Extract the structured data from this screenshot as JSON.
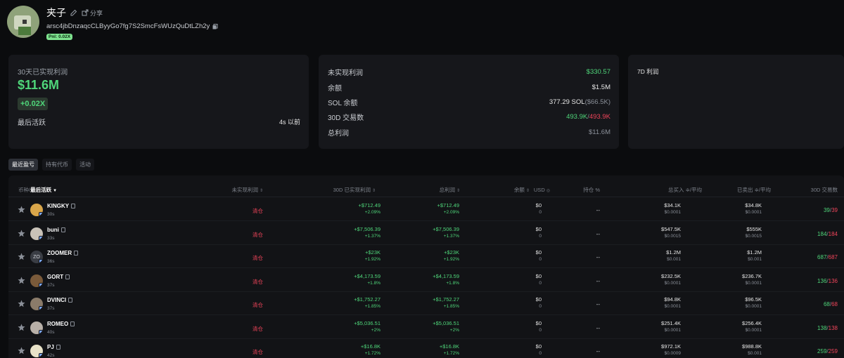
{
  "profile": {
    "name": "夹子",
    "share_label": "分享",
    "address": "arsc4jbDnzaqcCLByyGo7fg7S2SmcFsWUzQuDtLZh2y",
    "pnl_badge": "Pnl: 0.02X"
  },
  "card_realized": {
    "label": "30天已实现利润",
    "value": "$11.6M",
    "multiple": "+0.02X",
    "last_active_label": "最后活跃",
    "last_active_value": "4s 以前"
  },
  "card_stats": {
    "rows": [
      {
        "label": "未实现利润",
        "value": "$330.57"
      },
      {
        "label": "余额",
        "value": "$1.5M"
      },
      {
        "label": "SOL 余额",
        "value": "377.29 SOL",
        "value_paren": "($66.5K)"
      },
      {
        "label": "30D 交易数",
        "buys": "493.9K",
        "sep": "/",
        "sells": "493.9K"
      },
      {
        "label": "总利润",
        "value": "$11.6M"
      }
    ]
  },
  "card_7d": {
    "label": "7D 利润"
  },
  "tabs": [
    {
      "label": "最近盈亏",
      "active": true
    },
    {
      "label": "持有代币",
      "active": false
    },
    {
      "label": "活动",
      "active": false
    }
  ],
  "table": {
    "headers": {
      "token_prefix": "币种/",
      "token_sorted": "最后活跃",
      "unrealized": "未实现利润",
      "realized_30d": "30D 已实现利润",
      "total_profit": "总利润",
      "balance": "余额",
      "usd": "USD",
      "position": "持仓 %",
      "bought": "总买入 ≑/平均",
      "sold": "已卖出 ≑/平均",
      "tx_30d": "30D 交易数"
    },
    "closed_label": "清仓",
    "dash": "--",
    "rows": [
      {
        "name": "KINGKY",
        "age": "30s",
        "realized": "+$712.49",
        "realized_pct": "+2.09%",
        "total": "+$712.49",
        "total_pct": "+2.09%",
        "balance": "$0",
        "balance_sub": "0",
        "bought": "$34.1K",
        "bought_avg": "$0.0001",
        "sold": "$34.8K",
        "sold_avg": "$0.0001",
        "tx_buy": "39",
        "tx_sell": "39",
        "avatar_color": "#d9a64a"
      },
      {
        "name": "buni",
        "age": "33s",
        "realized": "+$7,506.39",
        "realized_pct": "+1.37%",
        "total": "+$7,506.39",
        "total_pct": "+1.37%",
        "balance": "$0",
        "balance_sub": "0",
        "bought": "$547.5K",
        "bought_avg": "$0.0015",
        "sold": "$555K",
        "sold_avg": "$0.0015",
        "tx_buy": "184",
        "tx_sell": "184",
        "avatar_color": "#c9c2b8"
      },
      {
        "name": "ZOOMER",
        "age": "36s",
        "realized": "+$23K",
        "realized_pct": "+1.92%",
        "total": "+$23K",
        "total_pct": "+1.92%",
        "balance": "$0",
        "balance_sub": "0",
        "bought": "$1.2M",
        "bought_avg": "$0.001",
        "sold": "$1.2M",
        "sold_avg": "$0.001",
        "tx_buy": "687",
        "tx_sell": "687",
        "avatar_text": "ZO"
      },
      {
        "name": "GORT",
        "age": "37s",
        "realized": "+$4,173.59",
        "realized_pct": "+1.8%",
        "total": "+$4,173.59",
        "total_pct": "+1.8%",
        "balance": "$0",
        "balance_sub": "0",
        "bought": "$232.5K",
        "bought_avg": "$0.0001",
        "sold": "$236.7K",
        "sold_avg": "$0.0001",
        "tx_buy": "136",
        "tx_sell": "136",
        "avatar_color": "#7a5a3a"
      },
      {
        "name": "DVINCI",
        "age": "37s",
        "realized": "+$1,752.27",
        "realized_pct": "+1.85%",
        "total": "+$1,752.27",
        "total_pct": "+1.85%",
        "balance": "$0",
        "balance_sub": "0",
        "bought": "$94.8K",
        "bought_avg": "$0.0001",
        "sold": "$96.5K",
        "sold_avg": "$0.0001",
        "tx_buy": "68",
        "tx_sell": "68",
        "avatar_color": "#8a7b6a"
      },
      {
        "name": "ROMEO",
        "age": "40s",
        "realized": "+$5,036.51",
        "realized_pct": "+2%",
        "total": "+$5,036.51",
        "total_pct": "+2%",
        "balance": "$0",
        "balance_sub": "0",
        "bought": "$251.4K",
        "bought_avg": "$0.0001",
        "sold": "$256.4K",
        "sold_avg": "$0.0001",
        "tx_buy": "138",
        "tx_sell": "138",
        "avatar_color": "#b8b0a8"
      },
      {
        "name": "PJ",
        "age": "42s",
        "realized": "+$16.8K",
        "realized_pct": "+1.72%",
        "total": "+$16.8K",
        "total_pct": "+1.72%",
        "balance": "$0",
        "balance_sub": "0",
        "bought": "$972.1K",
        "bought_avg": "$0.0009",
        "sold": "$988.8K",
        "sold_avg": "$0.001",
        "tx_buy": "259",
        "tx_sell": "259",
        "avatar_color": "#e8e2c8"
      }
    ]
  }
}
